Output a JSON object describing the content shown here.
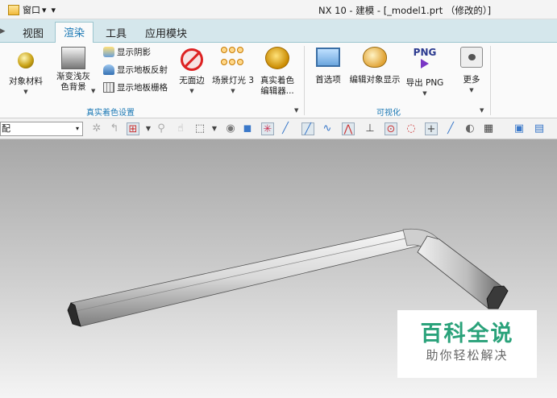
{
  "titlebar": {
    "window_menu": "窗口",
    "window_menu_arrow": "▾",
    "quick_access": "▾",
    "title": "NX 10 - 建模 - [_model1.prt （修改的）]"
  },
  "tabs": [
    {
      "label": "视图"
    },
    {
      "label": "渲染"
    },
    {
      "label": "工具"
    },
    {
      "label": "应用模块"
    }
  ],
  "ribbon": {
    "truetype_group": {
      "label": "真实着色设置",
      "object_material": "对象材料",
      "gradient_bg_line1": "渐变浅灰",
      "gradient_bg_line2": "色背景",
      "show_shadow": "显示阴影",
      "show_floor_reflection": "显示地板反射",
      "show_floor_grid": "显示地板栅格",
      "no_face_edges": "无面边",
      "scene_light": "场景灯光 3",
      "editor_line1": "真实着色",
      "editor_line2": "编辑器..."
    },
    "visualization_group": {
      "label": "可视化",
      "preferences": "首选项",
      "edit_object_display": "编辑对象显示",
      "export_png": "导出 PNG",
      "png_badge": "PNG",
      "more": "更多"
    }
  },
  "toolbar": {
    "filter_combo_value": "配",
    "filter_arrow": "▾"
  },
  "watermark": {
    "title": "百科全说",
    "subtitle": "助你轻松解决"
  },
  "colors": {
    "tab_active": "#1b78b4",
    "tabbar_bg": "#d5e7ec",
    "watermark_green": "#2aa27a"
  }
}
